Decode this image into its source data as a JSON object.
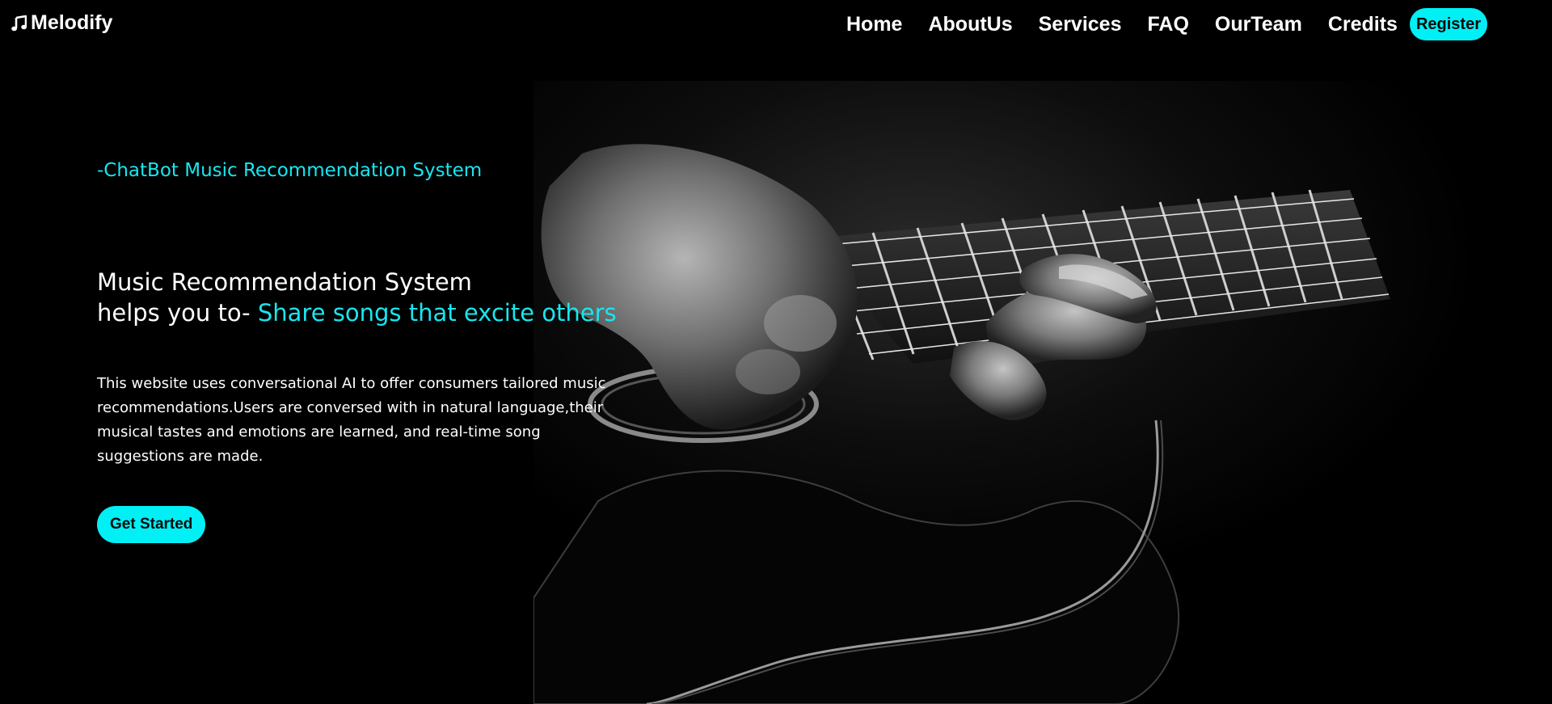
{
  "brand": {
    "name": "Melodify",
    "icon": "music-note-icon"
  },
  "nav": {
    "items": [
      {
        "label": "Home"
      },
      {
        "label": "AboutUs"
      },
      {
        "label": "Services"
      },
      {
        "label": "FAQ"
      },
      {
        "label": "OurTeam"
      },
      {
        "label": "Credits"
      }
    ],
    "register_label": "Register"
  },
  "hero": {
    "tagline": "-ChatBot Music Recommendation System",
    "headline_line1": "Music Recommendation System",
    "headline_prefix": "helps you to-",
    "headline_accent": "Share songs that excite others",
    "description": "This website uses conversational AI to offer consumers tailored music recommendations.Users are conversed with in natural language,their musical tastes and emotions are learned, and real-time song suggestions are made.",
    "cta_label": "Get Started",
    "image": "guitar-player-image"
  },
  "colors": {
    "background": "#000000",
    "accent": "#00f0f5",
    "text": "#ffffff"
  }
}
